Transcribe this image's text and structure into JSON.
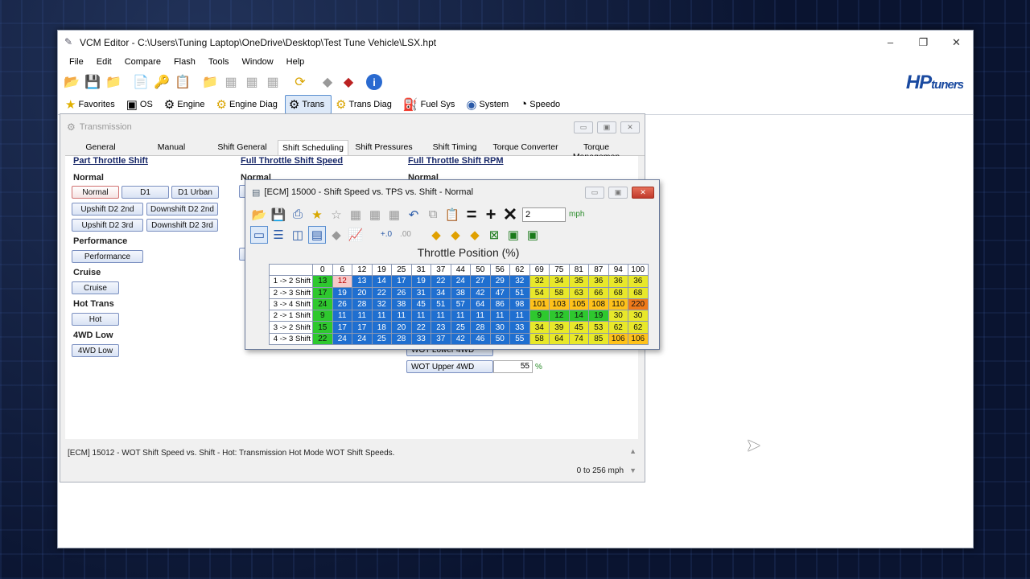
{
  "app": {
    "title": "VCM Editor - C:\\Users\\Tuning Laptop\\OneDrive\\Desktop\\Test Tune Vehicle\\LSX.hpt",
    "menu": [
      "File",
      "Edit",
      "Compare",
      "Flash",
      "Tools",
      "Window",
      "Help"
    ],
    "logo_main": "HP",
    "logo_sub": "tuners",
    "categories": [
      {
        "label": "Favorites",
        "icon": "star-icon"
      },
      {
        "label": "OS",
        "icon": "chip-icon"
      },
      {
        "label": "Engine",
        "icon": "engine-icon"
      },
      {
        "label": "Engine Diag",
        "icon": "engine-diag-icon"
      },
      {
        "label": "Trans",
        "icon": "gear-icon",
        "active": true
      },
      {
        "label": "Trans Diag",
        "icon": "gear-diag-icon"
      },
      {
        "label": "Fuel Sys",
        "icon": "fuel-pump-icon"
      },
      {
        "label": "System",
        "icon": "globe-icon"
      },
      {
        "label": "Speedo",
        "icon": "speedometer-icon"
      }
    ]
  },
  "transmission": {
    "title": "Transmission",
    "tabs": [
      "General",
      "Manual",
      "Shift General",
      "Shift Scheduling",
      "Shift Pressures",
      "Shift Timing",
      "Torque Converter",
      "Torque Managemen"
    ],
    "active_tab": "Shift Scheduling",
    "col_part": "Part Throttle Shift",
    "col_full_speed": "Full Throttle Shift Speed",
    "col_full_rpm": "Full Throttle Shift RPM",
    "normal_label": "Normal",
    "normal_buttons": [
      "Normal",
      "D1",
      "D1 Urban",
      "Upshift D2 2nd",
      "Downshift D2 2nd",
      "Upshift D2 3rd",
      "Downshift D2 3rd"
    ],
    "performance_label": "Performance",
    "performance_button": "Performance",
    "cruise_label": "Cruise",
    "cruise_button": "Cruise",
    "hottrans_label": "Hot Trans",
    "hot_button": "Hot",
    "fourwd_label": "4WD Low",
    "fourwd_button": "4WD Low",
    "col2_normal": "Normal",
    "col3_normal": "Normal",
    "wot_lower_label": "WOT Lower 4WD",
    "wot_upper_label": "WOT Upper 4WD",
    "wot_upper_value": "55",
    "pct_unit": "%",
    "status_desc": "[ECM] 15012 - WOT Shift Speed vs. Shift - Hot: Transmission Hot Mode WOT Shift Speeds.",
    "status_range": "0 to 256 mph"
  },
  "table_window": {
    "title": "[ECM] 15000 - Shift Speed vs. TPS vs. Shift - Normal",
    "multiplier_value": "2",
    "multiplier_unit": "mph",
    "axis_title": "Throttle Position (%)",
    "columns": [
      "0",
      "6",
      "12",
      "19",
      "25",
      "31",
      "37",
      "44",
      "50",
      "56",
      "62",
      "69",
      "75",
      "81",
      "87",
      "94",
      "100"
    ],
    "rows": [
      {
        "label": "1 -> 2 Shift",
        "values": [
          "13",
          "12",
          "13",
          "14",
          "17",
          "19",
          "22",
          "24",
          "27",
          "29",
          "32",
          "32",
          "34",
          "35",
          "36",
          "36",
          "36"
        ]
      },
      {
        "label": "2 -> 3 Shift",
        "values": [
          "17",
          "19",
          "20",
          "22",
          "26",
          "31",
          "34",
          "38",
          "42",
          "47",
          "51",
          "54",
          "58",
          "63",
          "66",
          "68",
          "68"
        ]
      },
      {
        "label": "3 -> 4 Shift",
        "values": [
          "24",
          "26",
          "28",
          "32",
          "38",
          "45",
          "51",
          "57",
          "64",
          "86",
          "98",
          "101",
          "103",
          "105",
          "108",
          "110",
          "220"
        ]
      },
      {
        "label": "2 -> 1 Shift",
        "values": [
          "9",
          "11",
          "11",
          "11",
          "11",
          "11",
          "11",
          "11",
          "11",
          "11",
          "11",
          "9",
          "12",
          "14",
          "19",
          "30",
          "30"
        ]
      },
      {
        "label": "3 -> 2 Shift",
        "values": [
          "15",
          "17",
          "17",
          "18",
          "20",
          "22",
          "23",
          "25",
          "28",
          "30",
          "33",
          "34",
          "39",
          "45",
          "53",
          "62",
          "62"
        ]
      },
      {
        "label": "4 -> 3 Shift",
        "values": [
          "22",
          "24",
          "24",
          "25",
          "28",
          "33",
          "37",
          "42",
          "46",
          "50",
          "55",
          "58",
          "64",
          "74",
          "85",
          "106",
          "106"
        ]
      }
    ],
    "cell_colors": [
      [
        "#2ec82e",
        "#f6c9c9",
        "#1f6fd0",
        "#1f6fd0",
        "#1f6fd0",
        "#1f6fd0",
        "#1f6fd0",
        "#1f6fd0",
        "#1f6fd0",
        "#1f6fd0",
        "#1f6fd0",
        "#e8e82a",
        "#e8e82a",
        "#e8e82a",
        "#e8e82a",
        "#e8e82a",
        "#e8e82a"
      ],
      [
        "#2ec82e",
        "#1f6fd0",
        "#1f6fd0",
        "#1f6fd0",
        "#1f6fd0",
        "#1f6fd0",
        "#1f6fd0",
        "#1f6fd0",
        "#1f6fd0",
        "#1f6fd0",
        "#1f6fd0",
        "#e8e82a",
        "#e8e82a",
        "#e8e82a",
        "#e8e82a",
        "#e8e82a",
        "#e8e82a"
      ],
      [
        "#2ec82e",
        "#1f6fd0",
        "#1f6fd0",
        "#1f6fd0",
        "#1f6fd0",
        "#1f6fd0",
        "#1f6fd0",
        "#1f6fd0",
        "#1f6fd0",
        "#1f6fd0",
        "#1f6fd0",
        "#ffc21a",
        "#ffc21a",
        "#ffc21a",
        "#ffc21a",
        "#ffc21a",
        "#f07a1a"
      ],
      [
        "#2ec82e",
        "#1f6fd0",
        "#1f6fd0",
        "#1f6fd0",
        "#1f6fd0",
        "#1f6fd0",
        "#1f6fd0",
        "#1f6fd0",
        "#1f6fd0",
        "#1f6fd0",
        "#1f6fd0",
        "#2ec82e",
        "#2ec82e",
        "#2ec82e",
        "#2ec82e",
        "#e8e82a",
        "#e8e82a"
      ],
      [
        "#2ec82e",
        "#1f6fd0",
        "#1f6fd0",
        "#1f6fd0",
        "#1f6fd0",
        "#1f6fd0",
        "#1f6fd0",
        "#1f6fd0",
        "#1f6fd0",
        "#1f6fd0",
        "#1f6fd0",
        "#e8e82a",
        "#e8e82a",
        "#e8e82a",
        "#e8e82a",
        "#e8e82a",
        "#e8e82a"
      ],
      [
        "#2ec82e",
        "#1f6fd0",
        "#1f6fd0",
        "#1f6fd0",
        "#1f6fd0",
        "#1f6fd0",
        "#1f6fd0",
        "#1f6fd0",
        "#1f6fd0",
        "#1f6fd0",
        "#1f6fd0",
        "#e8e82a",
        "#e8e82a",
        "#e8e82a",
        "#e8e82a",
        "#ffc21a",
        "#ffc21a"
      ]
    ]
  }
}
